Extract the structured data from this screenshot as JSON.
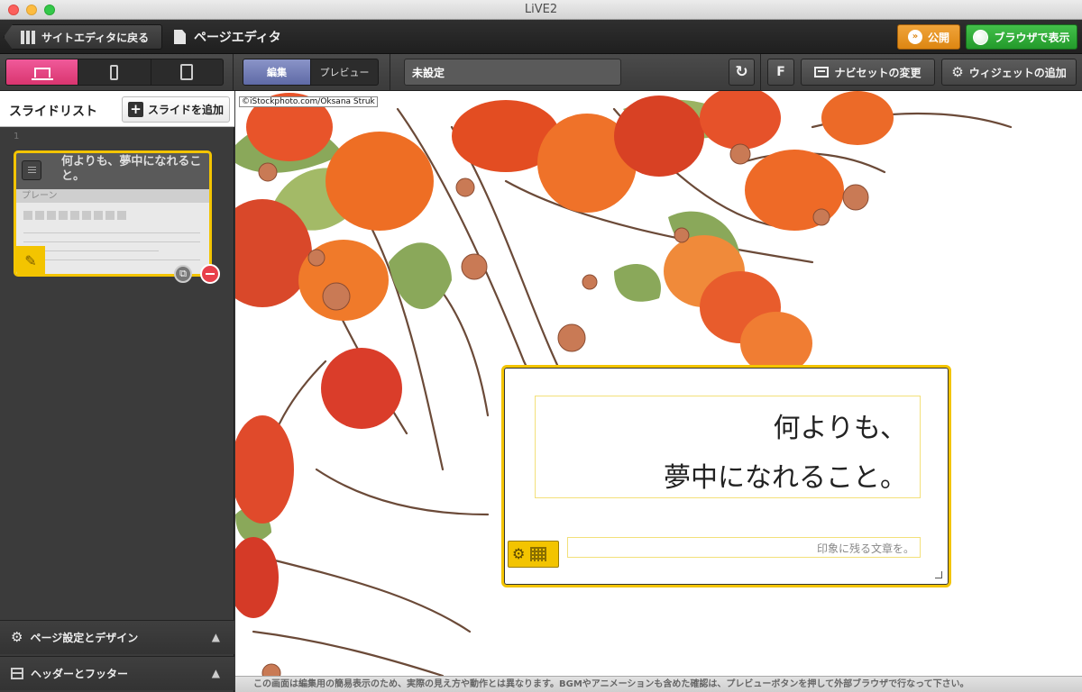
{
  "window": {
    "title": "LiVE2"
  },
  "topbar": {
    "back_label": "サイトエディタに戻る",
    "page_title": "ページエディタ",
    "publish_label": "公開",
    "browser_label": "ブラウザで表示"
  },
  "toolbar": {
    "devices": [
      "laptop",
      "phone",
      "tablet"
    ],
    "active_device": "laptop",
    "mode_edit": "編集",
    "mode_preview": "プレビュー",
    "page_name": "未設定",
    "refresh_icon": "refresh-icon",
    "f_label": "F",
    "navset_label": "ナビセットの変更",
    "widget_label": "ウィジェットの追加"
  },
  "sidebar": {
    "title": "スライドリスト",
    "add_slide_label": "スライドを追加",
    "slides": [
      {
        "number": "1",
        "title": "何よりも、夢中になれること。",
        "type": "プレーン"
      }
    ],
    "panels": [
      {
        "label": "ページ設定とデザイン",
        "icon": "gear-icon"
      },
      {
        "label": "ヘッダーとフッター",
        "icon": "header-footer-icon"
      }
    ]
  },
  "canvas": {
    "image_credit": "©iStockphoto.com/Oksana Struk",
    "headline_line1": "何よりも、",
    "headline_line2": "夢中になれること。",
    "subtext": "印象に残る文章を。"
  },
  "footer_note": "この画面は編集用の簡易表示のため、実際の見え方や動作とは異なります。BGMやアニメーションも含めた確認は、プレビューボタンを押して外部ブラウザで行なって下さい。",
  "colors": {
    "accent_pink": "#e0457f",
    "selection_yellow": "#f3c400",
    "publish_orange": "#e8941f",
    "browser_green": "#2fad36",
    "edit_mode_purple": "#6f79b5"
  }
}
